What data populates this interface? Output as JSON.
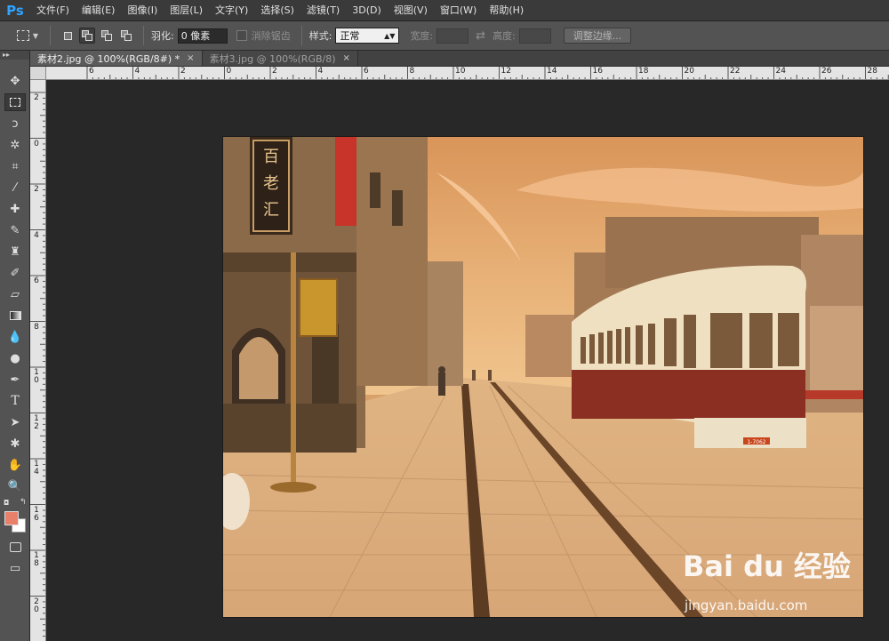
{
  "app": {
    "logo": "Ps"
  },
  "menu": {
    "items": [
      "文件(F)",
      "编辑(E)",
      "图像(I)",
      "图层(L)",
      "文字(Y)",
      "选择(S)",
      "滤镜(T)",
      "3D(D)",
      "视图(V)",
      "窗口(W)",
      "帮助(H)"
    ]
  },
  "options": {
    "feather_label": "羽化:",
    "feather_value": "0 像素",
    "antialias_label": "消除锯齿",
    "style_label": "样式:",
    "style_value": "正常",
    "width_label": "宽度:",
    "height_label": "高度:",
    "refine_edge_label": "调整边缘..."
  },
  "tabs": [
    {
      "label": "素材2.jpg @ 100%(RGB/8#) *",
      "close": "×"
    },
    {
      "label": "素材3.jpg @ 100%(RGB/8)",
      "close": "×"
    }
  ],
  "ruler": {
    "top": [
      "6",
      "4",
      "2",
      "0",
      "2",
      "4",
      "6",
      "8",
      "10",
      "12",
      "14",
      "16",
      "18",
      "20",
      "22",
      "24",
      "26",
      "28"
    ],
    "left": [
      "2",
      "0",
      "2",
      "4",
      "6",
      "8",
      "10",
      "12",
      "14",
      "16",
      "18",
      "20"
    ]
  },
  "colors": {
    "foreground": "#e8806a",
    "background": "#ffffff",
    "accent": "#2fa3ff"
  },
  "photo": {
    "signs": [
      "百",
      "老",
      "汇"
    ],
    "tram_plate": "1-7062"
  },
  "watermark": {
    "logo": "Bai du 经验",
    "url": "jingyan.baidu.com"
  },
  "tools": [
    "move-icon",
    "marquee-icon",
    "lasso-icon",
    "magic-wand-icon",
    "crop-icon",
    "eyedropper-icon",
    "healing-brush-icon",
    "brush-icon",
    "clone-stamp-icon",
    "history-brush-icon",
    "eraser-icon",
    "gradient-icon",
    "blur-icon",
    "dodge-icon",
    "pen-icon",
    "type-icon",
    "path-selection-icon",
    "shape-icon",
    "hand-icon",
    "zoom-icon",
    "quick-mask-icon",
    "screen-mode-icon"
  ]
}
